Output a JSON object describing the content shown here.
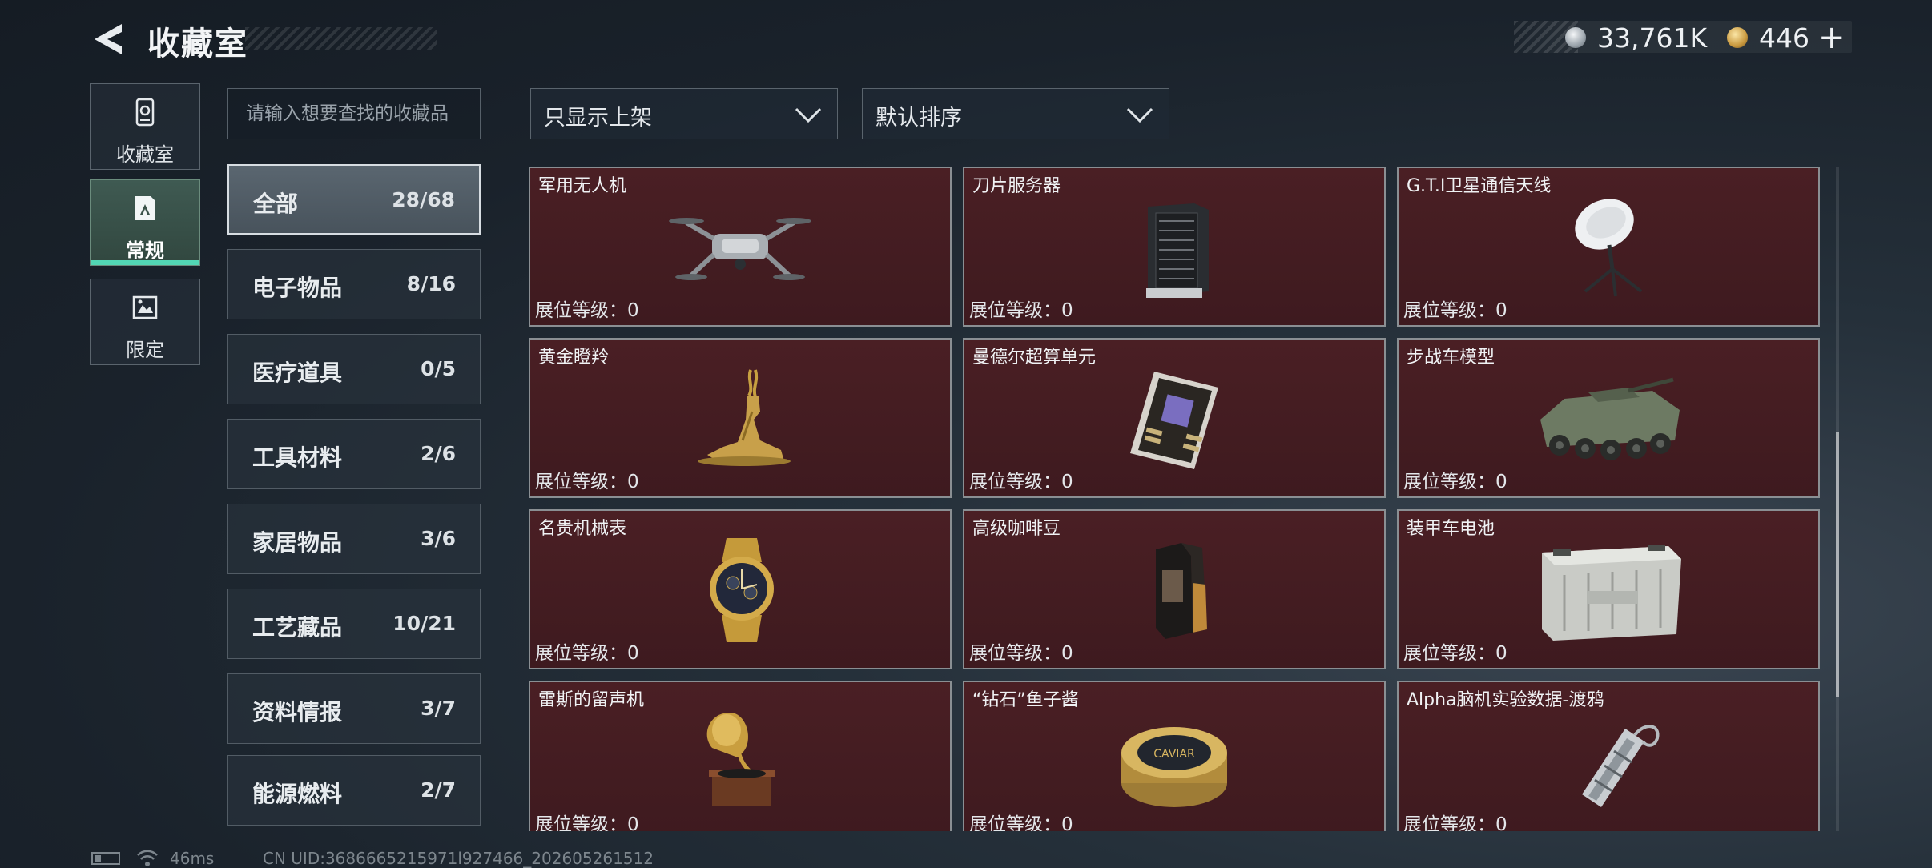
{
  "header": {
    "title": "收藏室",
    "currency_silver": "33,761K",
    "currency_gold": "446",
    "currency_plus": "+"
  },
  "nav": [
    {
      "label": "收藏室",
      "icon": "vault-icon"
    },
    {
      "label": "常规",
      "icon": "regular-card-icon",
      "active": true
    },
    {
      "label": "限定",
      "icon": "limited-card-icon"
    }
  ],
  "search": {
    "placeholder": "请输入想要查找的收藏品"
  },
  "filters": {
    "display": "只显示上架",
    "sort": "默认排序"
  },
  "categories": [
    {
      "name": "全部",
      "count": "28/68",
      "active": true
    },
    {
      "name": "电子物品",
      "count": "8/16"
    },
    {
      "name": "医疗道具",
      "count": "0/5"
    },
    {
      "name": "工具材料",
      "count": "2/6"
    },
    {
      "name": "家居物品",
      "count": "3/6"
    },
    {
      "name": "工艺藏品",
      "count": "10/21"
    },
    {
      "name": "资料情报",
      "count": "3/7"
    },
    {
      "name": "能源燃料",
      "count": "2/7"
    }
  ],
  "items": [
    {
      "name": "军用无人机",
      "level": "展位等级：0",
      "icon": "drone-icon"
    },
    {
      "name": "刀片服务器",
      "level": "展位等级：0",
      "icon": "server-icon"
    },
    {
      "name": "G.T.I卫星通信天线",
      "level": "展位等级：0",
      "icon": "satellite-dish-icon"
    },
    {
      "name": "黄金瞪羚",
      "level": "展位等级：0",
      "icon": "golden-gazelle-icon"
    },
    {
      "name": "曼德尔超算单元",
      "level": "展位等级：0",
      "icon": "supercomputer-board-icon"
    },
    {
      "name": "步战车模型",
      "level": "展位等级：0",
      "icon": "armored-vehicle-icon"
    },
    {
      "name": "名贵机械表",
      "level": "展位等级：0",
      "icon": "wristwatch-icon"
    },
    {
      "name": "高级咖啡豆",
      "level": "展位等级：0",
      "icon": "coffee-bag-icon"
    },
    {
      "name": "装甲车电池",
      "level": "展位等级：0",
      "icon": "battery-icon"
    },
    {
      "name": "雷斯的留声机",
      "level": "展位等级：0",
      "icon": "gramophone-icon"
    },
    {
      "name": "“钻石”鱼子酱",
      "level": "展位等级：0",
      "icon": "caviar-tin-icon"
    },
    {
      "name": "Alpha脑机实验数据-渡鸦",
      "level": "展位等级：0",
      "icon": "data-canister-icon"
    }
  ],
  "caviar_label": "CAVIAR",
  "status": {
    "ping": "46ms",
    "uid": "CN UID:3686665215971l927466_202605261512"
  }
}
